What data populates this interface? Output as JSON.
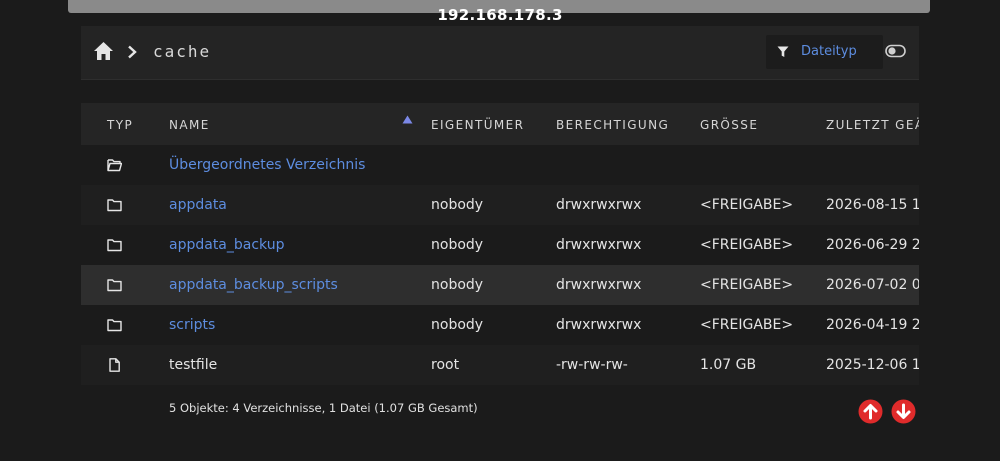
{
  "host": "192.168.178.3",
  "breadcrumb": {
    "current": "cache"
  },
  "filter": {
    "label": "Dateityp"
  },
  "columns": {
    "type": "TYP",
    "name": "NAME",
    "owner": "EIGENTÜMER",
    "permission": "BERECHTIGUNG",
    "size": "GRÖSSE",
    "modified": "ZULETZT GEÄ"
  },
  "parent": {
    "label": "Übergeordnetes Verzeichnis",
    "icon": "folder-open-icon"
  },
  "rows": [
    {
      "icon": "folder-icon",
      "name": "appdata",
      "owner": "nobody",
      "perm": "drwxrwxrwx",
      "size": "<FREIGABE>",
      "date": "2026-08-15 1"
    },
    {
      "icon": "folder-icon",
      "name": "appdata_backup",
      "owner": "nobody",
      "perm": "drwxrwxrwx",
      "size": "<FREIGABE>",
      "date": "2026-06-29 2"
    },
    {
      "icon": "folder-icon",
      "name": "appdata_backup_scripts",
      "owner": "nobody",
      "perm": "drwxrwxrwx",
      "size": "<FREIGABE>",
      "date": "2026-07-02 0"
    },
    {
      "icon": "folder-icon",
      "name": "scripts",
      "owner": "nobody",
      "perm": "drwxrwxrwx",
      "size": "<FREIGABE>",
      "date": "2026-04-19 2"
    },
    {
      "icon": "file-icon",
      "name": "testfile",
      "owner": "root",
      "perm": "-rw-rw-rw-",
      "size": "1.07 GB",
      "date": "2025-12-06 1"
    }
  ],
  "summary": "5 Objekte: 4 Verzeichnisse, 1 Datei (1.07 GB Gesamt)",
  "colors": {
    "accent": "#5d8de0",
    "scroll_buttons": "#e02b2b"
  }
}
